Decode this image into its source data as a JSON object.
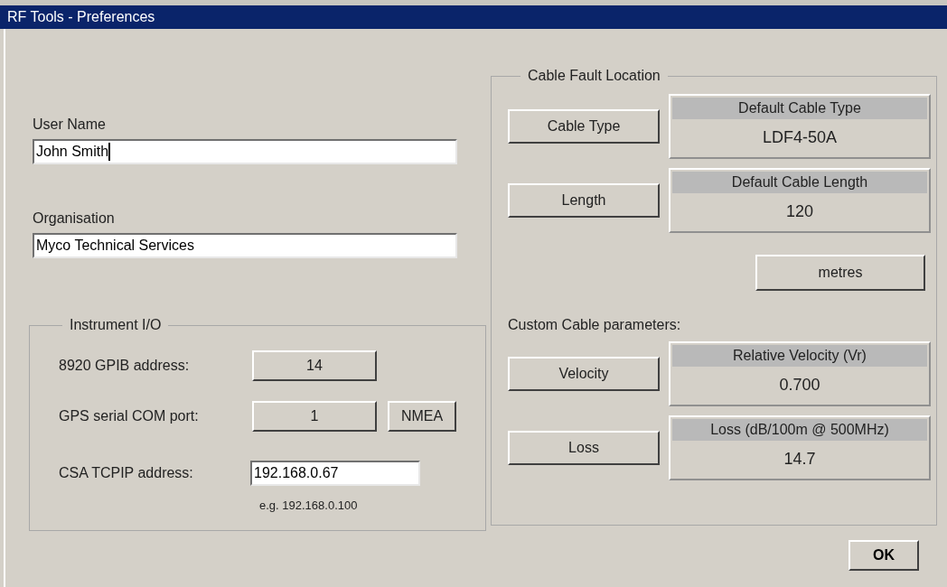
{
  "window": {
    "title": "RF Tools - Preferences"
  },
  "user_name": {
    "label": "User Name",
    "value": "John Smith",
    "focused": true
  },
  "organisation": {
    "label": "Organisation",
    "value": "Myco Technical Services",
    "focused": false
  },
  "instrument_io": {
    "title": "Instrument I/O",
    "rows": [
      {
        "kind": "button",
        "label": "8920 GPIB address:",
        "value": "14"
      },
      {
        "kind": "button",
        "label": "GPS serial COM port:",
        "value": "1",
        "extra": "NMEA"
      },
      {
        "kind": "field",
        "label": "CSA TCPIP address:",
        "value": "192.168.0.67",
        "hint": "e.g. 192.168.0.100"
      }
    ]
  },
  "cable_fault_location": {
    "title": "Cable Fault Location",
    "rows": [
      {
        "button": "Cable Type",
        "heading": "Default Cable Type",
        "value": "LDF4-50A"
      },
      {
        "button": "Length",
        "heading": "Default Cable Length",
        "value": "120"
      }
    ],
    "units_button": "metres",
    "custom_label": "Custom Cable parameters:",
    "custom_rows": [
      {
        "button": "Velocity",
        "heading": "Relative Velocity (Vr)",
        "value": "0.700"
      },
      {
        "button": "Loss",
        "heading": "Loss (dB/100m @ 500MHz)",
        "value": "14.7"
      }
    ]
  },
  "ok_button": "OK"
}
